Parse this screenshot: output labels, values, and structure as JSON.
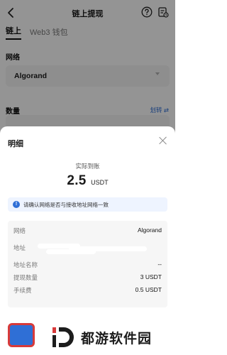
{
  "nav": {
    "title": "链上提现",
    "back_icon": "chevron-left-icon",
    "help_icon": "question-circle-icon",
    "record_icon": "record-list-icon"
  },
  "tabs": [
    {
      "label": "链上",
      "active": true
    },
    {
      "label": "Web3 钱包",
      "active": false
    }
  ],
  "network": {
    "label": "网络",
    "selected": "Algorand"
  },
  "quantity": {
    "label": "数量",
    "transfer_link": "划转 ⇄"
  },
  "sheet": {
    "title": "明细",
    "arrive_label": "实际到账",
    "amount": "2.5",
    "unit": "USDT",
    "notice": "请确认网络是否与接收地址网络一致",
    "details": [
      {
        "key": "网络",
        "value": "Algorand"
      },
      {
        "key": "地址",
        "value": ""
      },
      {
        "key": "地址名称",
        "value": "--"
      },
      {
        "key": "提现数量",
        "value": "3 USDT"
      },
      {
        "key": "手续费",
        "value": "0.5 USDT"
      }
    ]
  },
  "watermark": {
    "text": "都游软件园"
  },
  "colors": {
    "accent": "#2f6fd6",
    "notice_bg": "#eef4ff",
    "card_bg": "#f6f6f6"
  }
}
